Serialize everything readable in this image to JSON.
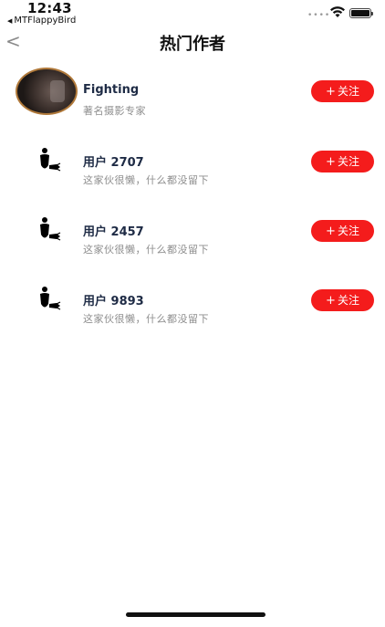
{
  "status_bar": {
    "time": "12:43",
    "back_app": "MTFlappyBird",
    "signal_dots": "••••"
  },
  "nav": {
    "back_glyph": "<",
    "title": "热门作者"
  },
  "authors": [
    {
      "name": "Fighting",
      "desc": "著名摄影专家",
      "avatar": "photo",
      "follow_label": "关注"
    },
    {
      "name": "用户 2707",
      "desc": "这家伙很懒，什么都没留下",
      "avatar": "default-user-icon",
      "follow_label": "关注"
    },
    {
      "name": "用户 2457",
      "desc": "这家伙很懒，什么都没留下",
      "avatar": "default-user-icon",
      "follow_label": "关注"
    },
    {
      "name": "用户 9893",
      "desc": "这家伙很懒，什么都没留下",
      "avatar": "default-user-icon",
      "follow_label": "关注"
    }
  ],
  "colors": {
    "accent": "#f41c1c",
    "name_text": "#1e2b45",
    "desc_text": "#8d8d8d"
  }
}
